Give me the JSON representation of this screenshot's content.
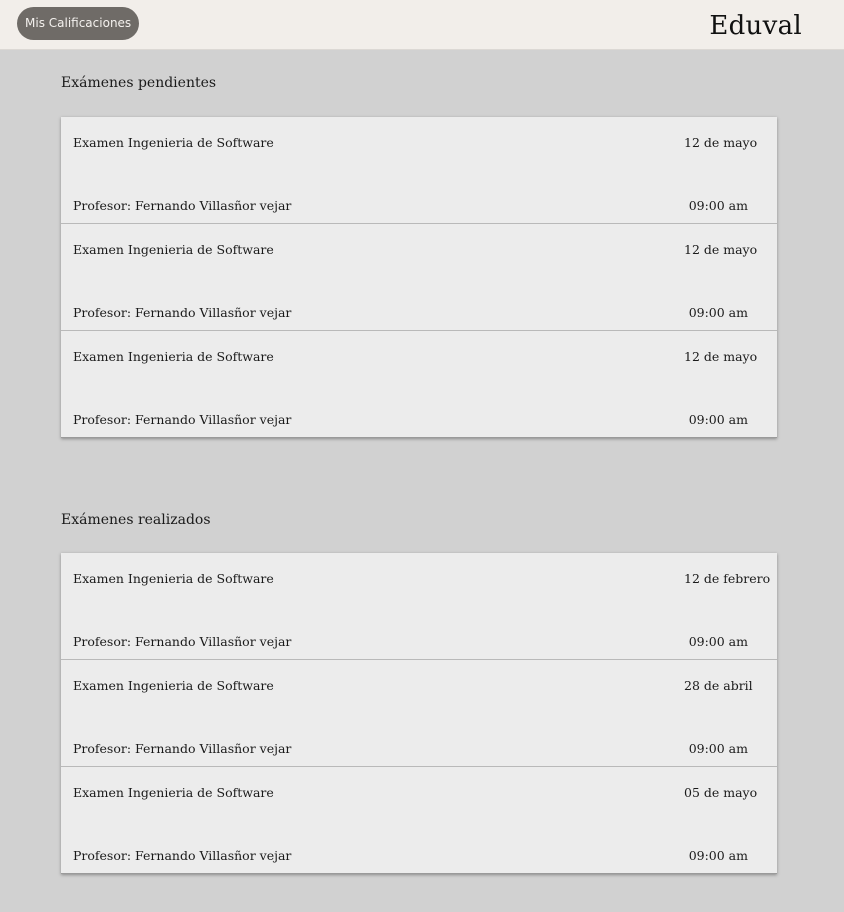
{
  "header": {
    "grades_button": "Mis Calificaciones",
    "brand": "Eduval"
  },
  "pending": {
    "title": "Exámenes pendientes",
    "exams": [
      {
        "name": "Examen Ingenieria de Software",
        "date": "12 de mayo",
        "professor": "Profesor: Fernando Villasñor vejar",
        "time": "09:00 am"
      },
      {
        "name": "Examen Ingenieria de Software",
        "date": "12 de mayo",
        "professor": "Profesor: Fernando Villasñor vejar",
        "time": "09:00 am"
      },
      {
        "name": "Examen Ingenieria de Software",
        "date": "12 de mayo",
        "professor": "Profesor: Fernando Villasñor vejar",
        "time": "09:00 am"
      }
    ]
  },
  "completed": {
    "title": "Exámenes realizados",
    "exams": [
      {
        "name": "Examen Ingenieria de Software",
        "date": "12 de febrero",
        "professor": "Profesor: Fernando Villasñor vejar",
        "time": "09:00 am"
      },
      {
        "name": "Examen Ingenieria de Software",
        "date": "28 de abril",
        "professor": "Profesor: Fernando Villasñor vejar",
        "time": "09:00 am"
      },
      {
        "name": "Examen Ingenieria de Software",
        "date": "05 de mayo",
        "professor": "Profesor: Fernando Villasñor vejar",
        "time": "09:00 am"
      }
    ]
  },
  "colors": {
    "background": "#d1d1d1",
    "header": "#f2eeea",
    "card": "#ececec",
    "button": "#6f6b67"
  }
}
